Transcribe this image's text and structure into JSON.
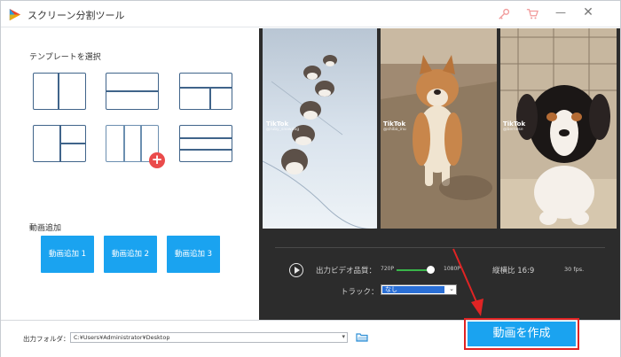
{
  "window": {
    "title": "スクリーン分割ツール",
    "minimize_symbol": "—",
    "close_symbol": "✕"
  },
  "templates": {
    "section_title": "テンプレートを選択",
    "items": [
      {
        "layout": "left-wide-right-split"
      },
      {
        "layout": "two-rows"
      },
      {
        "layout": "top-wide-bottom-split"
      },
      {
        "layout": "left-split-right-wide"
      },
      {
        "layout": "three-columns",
        "selected": true
      },
      {
        "layout": "three-rows"
      }
    ],
    "selected_badge": "+"
  },
  "add_video": {
    "section_title": "動画追加",
    "buttons": [
      "動画追加 1",
      "動画追加 2",
      "動画追加 3"
    ]
  },
  "preview": {
    "videos": [
      {
        "watermark": "TikTok",
        "handle": "@ruby_snowdog"
      },
      {
        "watermark": "TikTok",
        "handle": "@shiba_inu"
      },
      {
        "watermark": "TikTok",
        "handle": "@bernese"
      }
    ]
  },
  "controls": {
    "quality_label": "出力ビデオ品質：",
    "quality_low": "720P",
    "quality_high": "1080P",
    "quality_value": 0.95,
    "aspect_ratio": "縦横比 16:9",
    "fps": "30 fps.",
    "track_label": "トラック：",
    "track_value": "なし"
  },
  "output": {
    "folder_label": "出力フォルダ：",
    "folder_path": "C:¥Users¥Administrator¥Desktop"
  },
  "create_button": "動画を作成",
  "colors": {
    "accent_blue": "#1aa3f0",
    "highlight_red": "#e02424",
    "badge_red": "#ea4b4b",
    "slider_green": "#39b54a",
    "preview_bg": "#2c2c2c"
  }
}
